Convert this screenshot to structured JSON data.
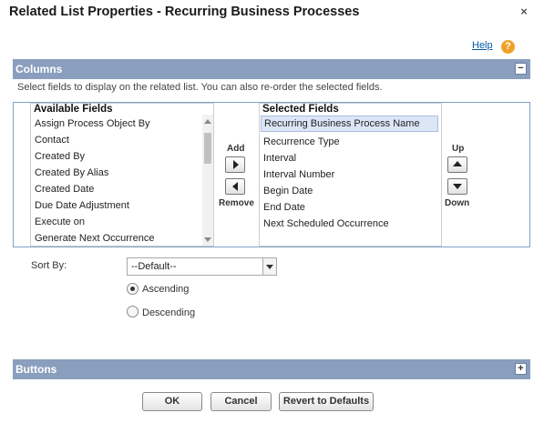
{
  "dialog": {
    "title": "Related List Properties - Recurring Business Processes",
    "close_symbol": "×",
    "help_label": "Help",
    "help_symbol": "?"
  },
  "columns_section": {
    "label": "Columns",
    "toggle_symbol": "−",
    "instructions": "Select fields to display on the related list. You can also re-order the selected fields."
  },
  "available": {
    "header": "Available Fields",
    "items": [
      "Assign Process Object By",
      "Contact",
      "Created By",
      "Created By Alias",
      "Created Date",
      "Due Date Adjustment",
      "Execute on",
      "Generate Next Occurrence"
    ]
  },
  "selected": {
    "header": "Selected Fields",
    "items": [
      "Recurring Business Process Name",
      "Recurrence Type",
      "Interval",
      "Interval Number",
      "Begin Date",
      "End Date",
      "Next Scheduled Occurrence"
    ]
  },
  "move_controls": {
    "add_label": "Add",
    "remove_label": "Remove",
    "up_label": "Up",
    "down_label": "Down"
  },
  "sort": {
    "label": "Sort By:",
    "selected_value": "--Default--",
    "ascending_label": "Ascending",
    "descending_label": "Descending",
    "order": "ascending"
  },
  "buttons_section": {
    "label": "Buttons",
    "toggle_symbol": "+"
  },
  "footer": {
    "ok_label": "OK",
    "cancel_label": "Cancel",
    "revert_label": "Revert to Defaults"
  },
  "colors": {
    "section_bar": "#8a9ebe",
    "frame_border": "#7fa1c9",
    "help_icon": "#f0a228",
    "link": "#015ba7"
  }
}
